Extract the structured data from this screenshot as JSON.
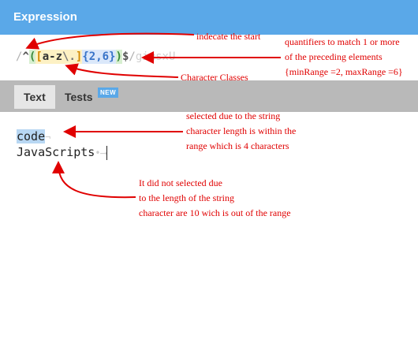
{
  "header": {
    "title": "Expression"
  },
  "expression": {
    "open_slash": "/",
    "start_anchor": "^",
    "group_open": "(",
    "set_open": "[",
    "range": "a-z",
    "escape": "\\.",
    "set_close": "]",
    "quantifier": "{2,6}",
    "group_close": ")",
    "end_anchor": "$",
    "close_slash": "/",
    "flags": "gimsxU"
  },
  "tabs": [
    {
      "label": "Text"
    },
    {
      "label": "Tests",
      "badge": "NEW"
    }
  ],
  "text_panel": {
    "line1": {
      "matched": "code",
      "eol": "¬"
    },
    "line2": {
      "text": "JavaScripts",
      "trailing": "•⟶"
    }
  },
  "annotations": {
    "start": "indecate the start",
    "quantifier": [
      "quantifiers to match 1 or more",
      "of the preceding elements",
      "{minRange =2, maxRange =6}"
    ],
    "classes": "Character Classes",
    "selected": [
      "selected due to the string",
      "character length is within the",
      "range which is 4 characters"
    ],
    "not_selected": [
      "It did not selected due",
      "to the length of the string",
      "character are 10 wich is out of the range"
    ]
  },
  "colors": {
    "header": "#5aa8e8",
    "annotation": "#e00000",
    "match_highlight": "#b8d7f3"
  }
}
